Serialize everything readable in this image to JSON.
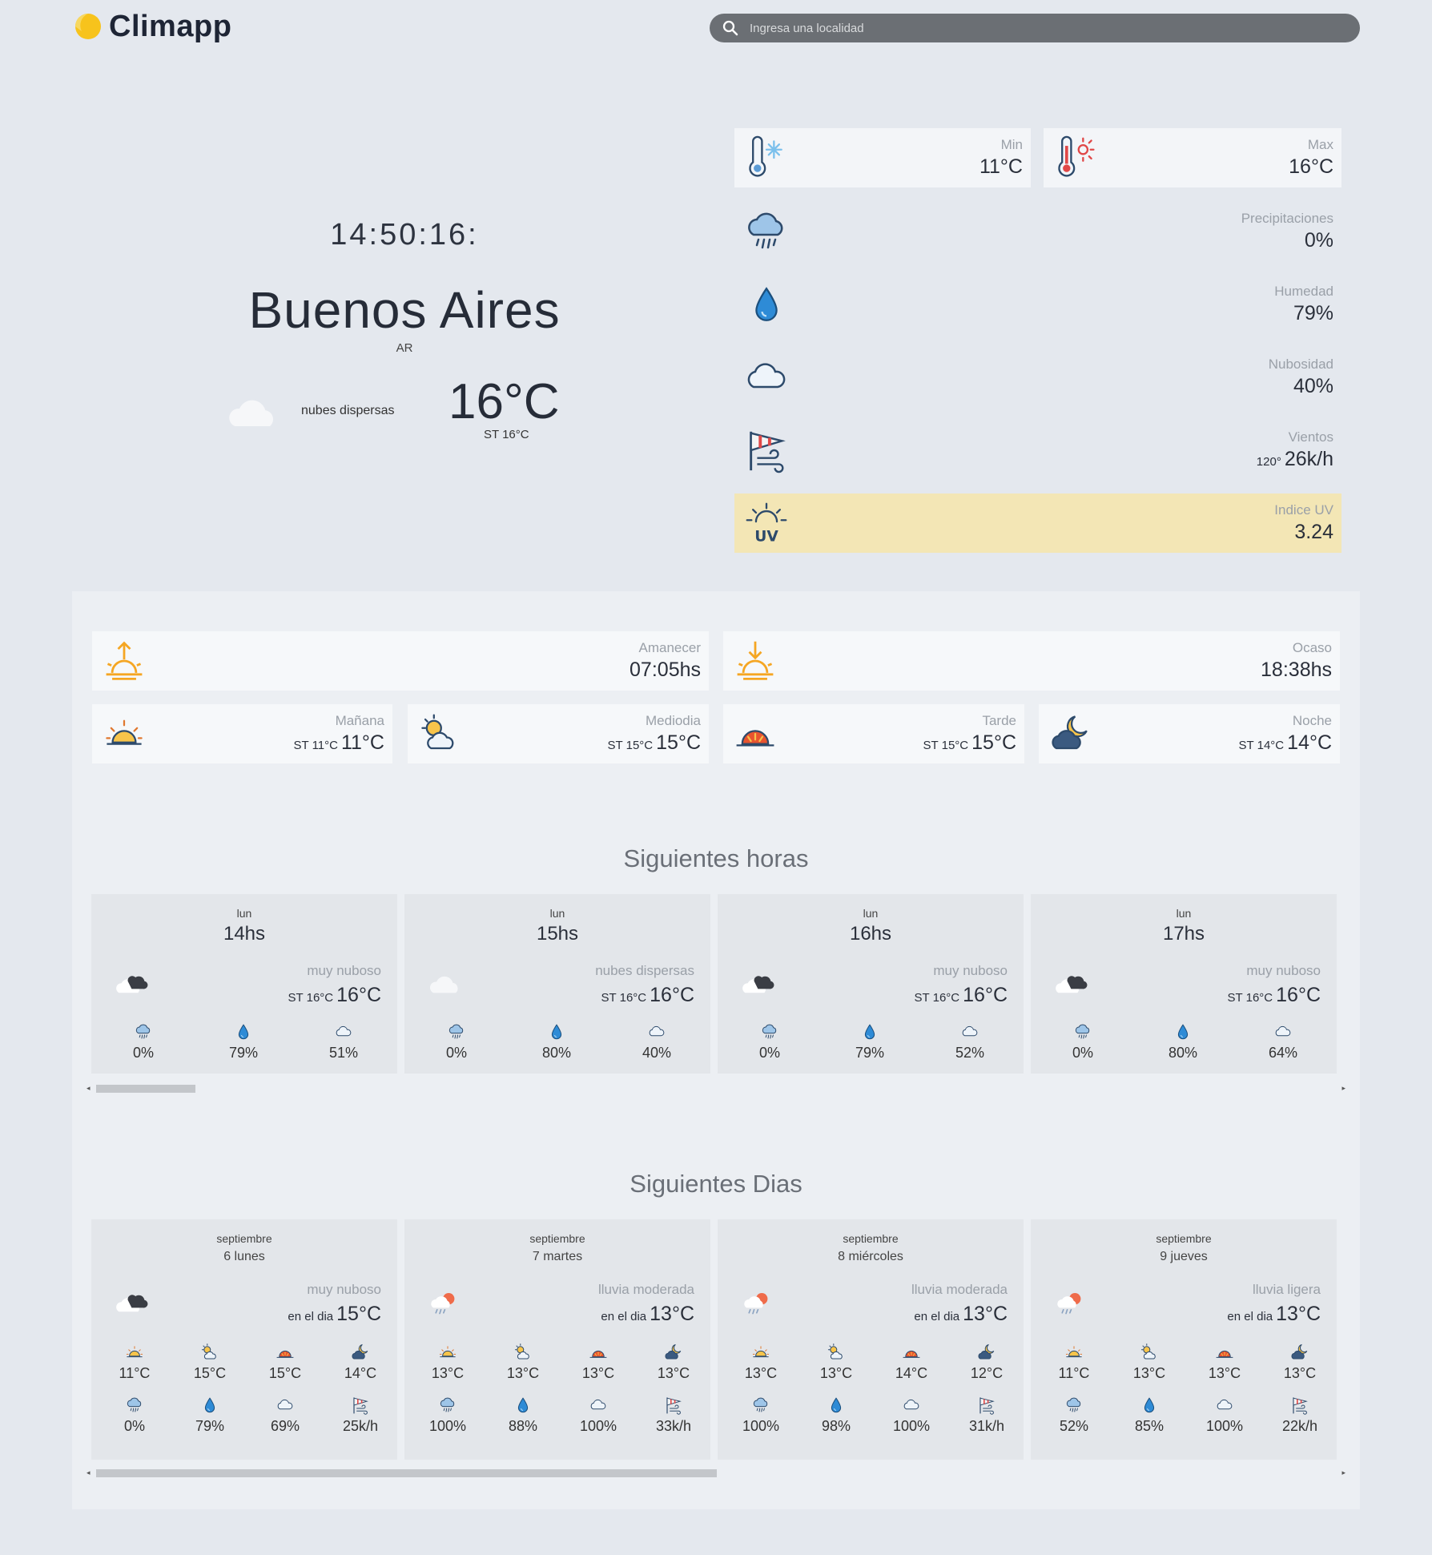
{
  "app": {
    "name": "Climapp"
  },
  "search": {
    "placeholder": "Ingresa una localidad"
  },
  "current": {
    "clock": "14:50:16:",
    "city": "Buenos Aires",
    "country": "AR",
    "description": "nubes dispersas",
    "temp": "16°C",
    "feels": "ST 16°C"
  },
  "stats": {
    "min": {
      "label": "Min",
      "value": "11°C"
    },
    "max": {
      "label": "Max",
      "value": "16°C"
    },
    "precip": {
      "label": "Precipitaciones",
      "value": "0%"
    },
    "humidity": {
      "label": "Humedad",
      "value": "79%"
    },
    "cloudiness": {
      "label": "Nubosidad",
      "value": "40%"
    },
    "wind": {
      "label": "Vientos",
      "dir": "120°",
      "value": "26k/h"
    },
    "uv": {
      "label": "Indice UV",
      "value": "3.24"
    }
  },
  "sun": {
    "sunrise": {
      "label": "Amanecer",
      "value": "07:05hs"
    },
    "sunset": {
      "label": "Ocaso",
      "value": "18:38hs"
    }
  },
  "dayparts": [
    {
      "label": "Mañana",
      "st": "ST 11°C",
      "temp": "11°C"
    },
    {
      "label": "Mediodia",
      "st": "ST 15°C",
      "temp": "15°C"
    },
    {
      "label": "Tarde",
      "st": "ST 15°C",
      "temp": "15°C"
    },
    {
      "label": "Noche",
      "st": "ST 14°C",
      "temp": "14°C"
    }
  ],
  "hourly_title": "Siguientes horas",
  "hourly": [
    {
      "day": "lun",
      "hour": "14hs",
      "desc": "muy nuboso",
      "st": "ST 16°C",
      "temp": "16°C",
      "precip": "0%",
      "hum": "79%",
      "cloud": "51%"
    },
    {
      "day": "lun",
      "hour": "15hs",
      "desc": "nubes dispersas",
      "st": "ST 16°C",
      "temp": "16°C",
      "precip": "0%",
      "hum": "80%",
      "cloud": "40%"
    },
    {
      "day": "lun",
      "hour": "16hs",
      "desc": "muy nuboso",
      "st": "ST 16°C",
      "temp": "16°C",
      "precip": "0%",
      "hum": "79%",
      "cloud": "52%"
    },
    {
      "day": "lun",
      "hour": "17hs",
      "desc": "muy nuboso",
      "st": "ST 16°C",
      "temp": "16°C",
      "precip": "0%",
      "hum": "80%",
      "cloud": "64%"
    }
  ],
  "daily_title": "Siguientes Dias",
  "daily": [
    {
      "month": "septiembre",
      "day": "6 lunes",
      "desc": "muy nuboso",
      "prefix": "en el dia",
      "temp": "15°C",
      "parts": [
        "11°C",
        "15°C",
        "15°C",
        "14°C"
      ],
      "precip": "0%",
      "hum": "79%",
      "cloud": "69%",
      "wind": "25k/h"
    },
    {
      "month": "septiembre",
      "day": "7 martes",
      "desc": "lluvia moderada",
      "prefix": "en el dia",
      "temp": "13°C",
      "parts": [
        "13°C",
        "13°C",
        "13°C",
        "13°C"
      ],
      "precip": "100%",
      "hum": "88%",
      "cloud": "100%",
      "wind": "33k/h"
    },
    {
      "month": "septiembre",
      "day": "8 miércoles",
      "desc": "lluvia moderada",
      "prefix": "en el dia",
      "temp": "13°C",
      "parts": [
        "13°C",
        "13°C",
        "14°C",
        "12°C"
      ],
      "precip": "100%",
      "hum": "98%",
      "cloud": "100%",
      "wind": "31k/h"
    },
    {
      "month": "septiembre",
      "day": "9 jueves",
      "desc": "lluvia ligera",
      "prefix": "en el dia",
      "temp": "13°C",
      "parts": [
        "11°C",
        "13°C",
        "13°C",
        "13°C"
      ],
      "precip": "52%",
      "hum": "85%",
      "cloud": "100%",
      "wind": "22k/h"
    }
  ],
  "scroll": {
    "hourly_thumb": 0.08,
    "daily_thumb": 0.5
  },
  "colors": {
    "uv_bg": "#f3e6b5",
    "accent_sun": "#f5a623",
    "drop": "#2e8bd6"
  }
}
